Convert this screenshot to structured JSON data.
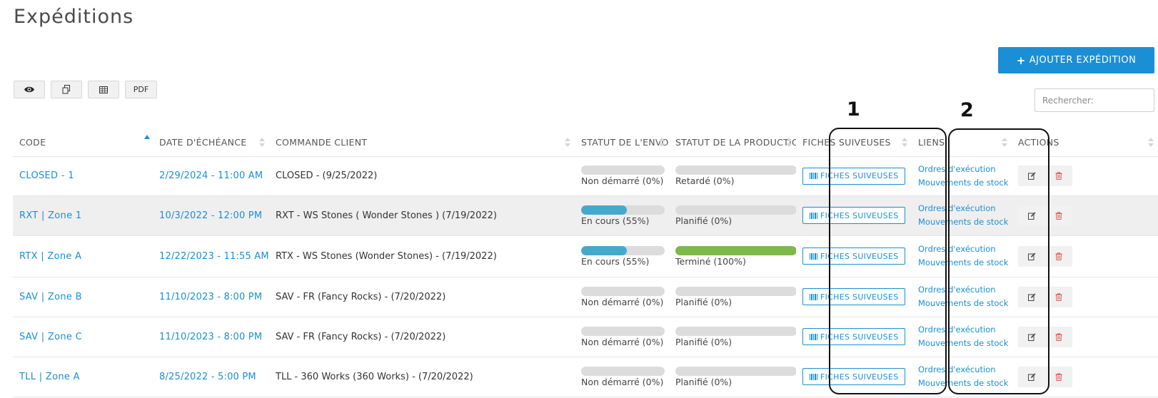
{
  "page": {
    "title": "Expéditions"
  },
  "header": {
    "add_button_label": "AJOUTER EXPÉDITION",
    "add_button_icon": "plus-icon"
  },
  "toolbar": [
    {
      "name": "view-toggle-button",
      "icon": "eye-icon",
      "label": ""
    },
    {
      "name": "copy-button",
      "icon": "copy-icon",
      "label": ""
    },
    {
      "name": "excel-export-button",
      "icon": "table-icon",
      "label": ""
    },
    {
      "name": "pdf-export-button",
      "icon": "",
      "label": "PDF"
    }
  ],
  "search": {
    "placeholder": "Rechercher:",
    "value": ""
  },
  "annotations": [
    "1",
    "2"
  ],
  "table": {
    "columns": [
      "CODE",
      "DATE D'ÉCHÉANCE",
      "COMMANDE CLIENT",
      "STATUT DE L'ENVOI",
      "STATUT DE LA PRODUCTION",
      "FICHES SUIVEUSES",
      "LIENS",
      "ACTIONS"
    ],
    "sorted_column": "DATE D'ÉCHÉANCE",
    "fiches_button_label": "FICHES SUIVEUSES",
    "links": {
      "orders": "Ordres d'exécution",
      "stock": "Mouvements de stock"
    },
    "rows": [
      {
        "code": "CLOSED - 1",
        "date": "2/29/2024 - 11:00 AM",
        "order": "CLOSED - (9/25/2022)",
        "shipping": {
          "label": "Non démarré (0%)",
          "pct": 0
        },
        "production": {
          "label": "Retardé (0%)",
          "pct": 0
        }
      },
      {
        "code": "RXT | Zone 1",
        "date": "10/3/2022 - 12:00 PM",
        "order": "RXT - WS Stones ( Wonder Stones ) (7/19/2022)",
        "shipping": {
          "label": "En cours (55%)",
          "pct": 55
        },
        "production": {
          "label": "Planifié (0%)",
          "pct": 0
        }
      },
      {
        "code": "RTX | Zone A",
        "date": "12/22/2023 - 11:55 AM",
        "order": "RTX - WS Stones (Wonder Stones) - (7/19/2022)",
        "shipping": {
          "label": "En cours (55%)",
          "pct": 55
        },
        "production": {
          "label": "Terminé (100%)",
          "pct": 100
        }
      },
      {
        "code": "SAV | Zone B",
        "date": "11/10/2023 - 8:00 PM",
        "order": "SAV - FR (Fancy Rocks) - (7/20/2022)",
        "shipping": {
          "label": "Non démarré (0%)",
          "pct": 0
        },
        "production": {
          "label": "Planifié (0%)",
          "pct": 0
        }
      },
      {
        "code": "SAV | Zone C",
        "date": "11/10/2023 - 8:00 PM",
        "order": "SAV - FR (Fancy Rocks) - (7/20/2022)",
        "shipping": {
          "label": "Non démarré (0%)",
          "pct": 0
        },
        "production": {
          "label": "Planifié (0%)",
          "pct": 0
        }
      },
      {
        "code": "TLL | Zone A",
        "date": "8/25/2022 - 5:00 PM",
        "order": "TLL - 360 Works (360 Works) - (7/20/2022)",
        "shipping": {
          "label": "Non démarré (0%)",
          "pct": 0
        },
        "production": {
          "label": "Planifié (0%)",
          "pct": 0
        }
      }
    ]
  },
  "colors": {
    "accent": "#1a8fd6",
    "progress_blue": "#45a9cc",
    "progress_green": "#7fb84a",
    "delete": "#e05a5a"
  }
}
